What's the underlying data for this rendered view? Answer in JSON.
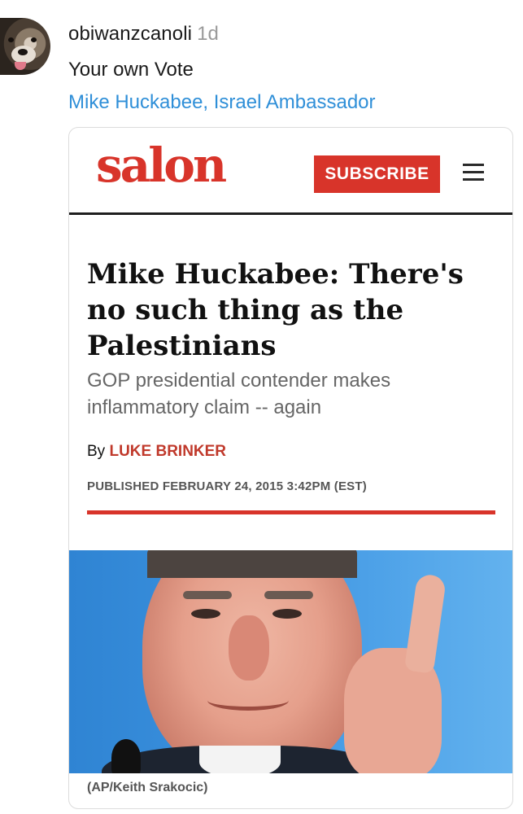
{
  "comment": {
    "username": "obiwanzcanoli",
    "time": "1d",
    "text": "Your own Vote",
    "link_text": "Mike Huckabee, Israel Ambassador"
  },
  "article": {
    "logo": "salon",
    "subscribe_label": "SUBSCRIBE",
    "menu_icon": "hamburger-menu-icon",
    "headline": "Mike Huckabee: There's no such thing as the Palestinians",
    "subhead": "GOP presidential contender makes inflammatory claim -- again",
    "byline_prefix": "By",
    "author": "LUKE BRINKER",
    "published": "PUBLISHED FEBRUARY 24, 2015 3:42PM (EST)",
    "photo_caption": "(AP/Keith Srakocic)"
  },
  "colors": {
    "brand_red": "#d8342a",
    "link_blue": "#2f8fd8"
  }
}
